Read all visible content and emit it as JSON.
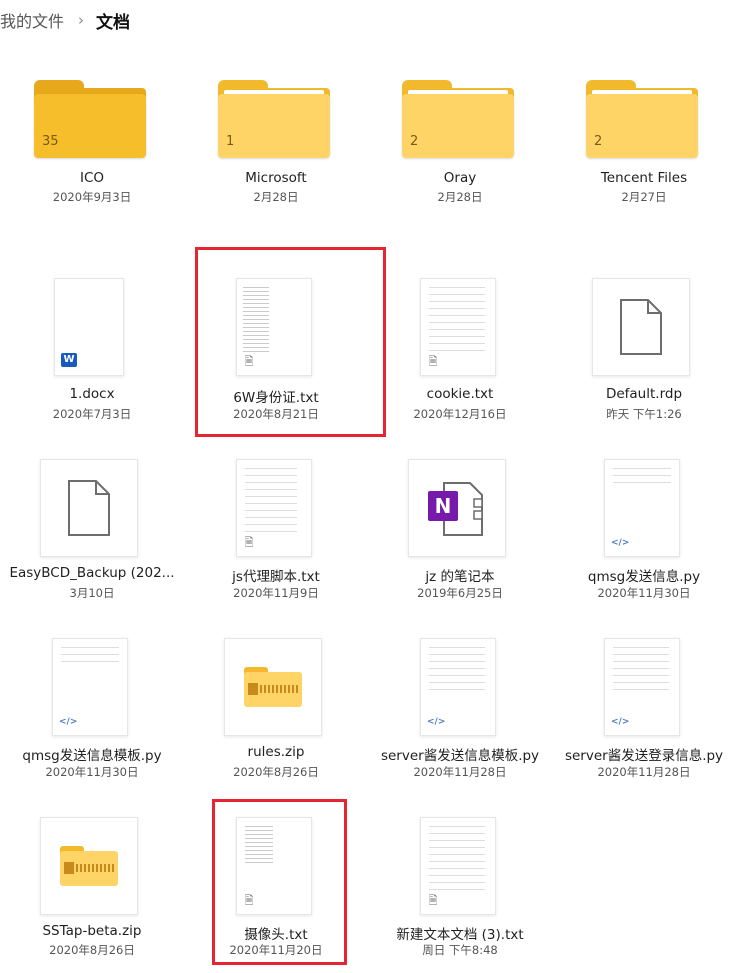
{
  "breadcrumb": {
    "parent": "我的文件",
    "current": "文档"
  },
  "folders": [
    {
      "name": "ICO",
      "date": "2020年9月3日",
      "count": "35",
      "style": "full"
    },
    {
      "name": "Microsoft",
      "date": "2月28日",
      "count": "1",
      "style": "light"
    },
    {
      "name": "Oray",
      "date": "2月28日",
      "count": "2",
      "style": "light"
    },
    {
      "name": "Tencent Files",
      "date": "2月27日",
      "count": "2",
      "style": "light"
    }
  ],
  "files": [
    {
      "name": "1.docx",
      "date": "2020年7月3日",
      "icon": "word-icon"
    },
    {
      "name": "6W身份证.txt",
      "date": "2020年8月21日",
      "icon": "text-file-icon"
    },
    {
      "name": "cookie.txt",
      "date": "2020年12月16日",
      "icon": "text-file-icon"
    },
    {
      "name": "Default.rdp",
      "date": "昨天 下午1:26",
      "icon": "blank-file-icon"
    },
    {
      "name": "EasyBCD_Backup (202...",
      "date": "3月10日",
      "icon": "blank-file-icon"
    },
    {
      "name": "js代理脚本.txt",
      "date": "2020年11月9日",
      "icon": "text-file-icon"
    },
    {
      "name": "jz 的笔记本",
      "date": "2019年6月25日",
      "icon": "onenote-icon"
    },
    {
      "name": "qmsg发送信息.py",
      "date": "2020年11月30日",
      "icon": "python-file-icon"
    },
    {
      "name": "qmsg发送信息模板.py",
      "date": "2020年11月30日",
      "icon": "python-file-icon"
    },
    {
      "name": "rules.zip",
      "date": "2020年8月26日",
      "icon": "zip-folder-icon"
    },
    {
      "name": "server酱发送信息模板.py",
      "date": "2020年11月28日",
      "icon": "python-file-icon"
    },
    {
      "name": "server酱发送登录信息.py",
      "date": "2020年11月28日",
      "icon": "python-file-icon"
    },
    {
      "name": "SSTap-beta.zip",
      "date": "2020年8月26日",
      "icon": "zip-folder-icon"
    },
    {
      "name": "摄像头.txt",
      "date": "2020年11月20日",
      "icon": "text-file-icon"
    },
    {
      "name": "新建文本文档 (3).txt",
      "date": "周日 下午8:48",
      "icon": "text-file-icon"
    }
  ],
  "colors": {
    "highlight": "#e52531",
    "folder": "#ffd467",
    "folder_dark": "#f2b92c"
  }
}
